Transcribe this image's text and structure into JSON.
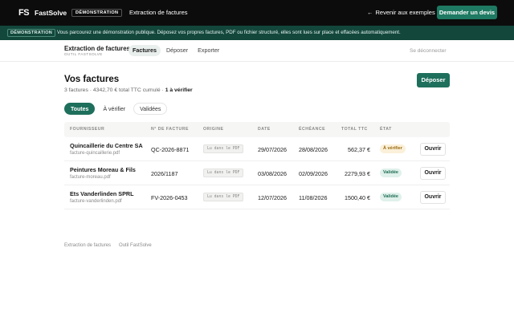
{
  "topbar": {
    "logo_mark": "FS",
    "brand": "FastSolve",
    "demo_badge": "DÉMONSTRATION",
    "title": "Extraction de factures",
    "back_link": "Revenir aux exemples",
    "quote_button": "Demander un devis",
    "accent": "#1e7a62"
  },
  "banner": {
    "badge": "DÉMONSTRATION",
    "text": "Vous parcourez une démonstration publique. Déposez vos propres factures, PDF ou fichier structuré, elles sont lues sur place et effacées automatiquement."
  },
  "header": {
    "app_name": "Extraction de factures",
    "app_sub": "OUTIL FASTSOLVE",
    "tabs": [
      {
        "label": "Factures",
        "active": true
      },
      {
        "label": "Déposer",
        "active": false
      },
      {
        "label": "Exporter",
        "active": false
      }
    ],
    "logout": "Se déconnecter"
  },
  "main": {
    "title": "Vos factures",
    "summary_prefix": "3 factures · 4342,70 € total TTC cumulé · ",
    "summary_bold": "1 à vérifier",
    "upload_button": "Déposer",
    "filters": [
      {
        "label": "Toutes",
        "active": true
      },
      {
        "label": "À vérifier",
        "active": false
      },
      {
        "label": "Validées",
        "active": false
      }
    ]
  },
  "table": {
    "columns": [
      "FOURNISSEUR",
      "N° DE FACTURE",
      "ORIGINE",
      "DATE",
      "ÉCHÉANCE",
      "TOTAL TTC",
      "ÉTAT"
    ],
    "rows": [
      {
        "supplier": "Quincaillerie du Centre SA",
        "file": "facture-quincaillerie.pdf",
        "number": "QC-2026-8871",
        "origin": "Lu dans le PDF",
        "date": "29/07/2026",
        "due": "28/08/2026",
        "total": "562,37 €",
        "status": "À vérifier",
        "status_kind": "warn",
        "action": "Ouvrir"
      },
      {
        "supplier": "Peintures Moreau & Fils",
        "file": "facture-moreau.pdf",
        "number": "2026/1187",
        "origin": "Lu dans le PDF",
        "date": "03/08/2026",
        "due": "02/09/2026",
        "total": "2279,93 €",
        "status": "Validée",
        "status_kind": "ok",
        "action": "Ouvrir"
      },
      {
        "supplier": "Ets Vanderlinden SPRL",
        "file": "facture-vanderlinden.pdf",
        "number": "FV-2026-0453",
        "origin": "Lu dans le PDF",
        "date": "12/07/2026",
        "due": "11/08/2026",
        "total": "1500,40 €",
        "status": "Validée",
        "status_kind": "ok",
        "action": "Ouvrir"
      }
    ]
  },
  "footer": {
    "left": "Extraction de factures",
    "right": "Outil FastSolve"
  }
}
